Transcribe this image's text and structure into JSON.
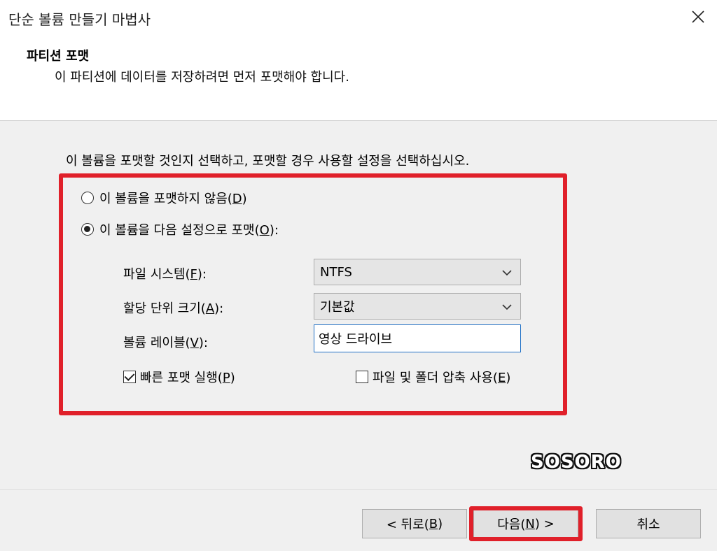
{
  "window": {
    "title": "단순 볼륨 만들기 마법사",
    "close_icon": "close-icon"
  },
  "header": {
    "heading": "파티션 포맷",
    "subheading": "이 파티션에 데이터를 저장하려면 먼저 포맷해야 합니다."
  },
  "body": {
    "instruction": "이 볼륨을 포맷할 것인지 선택하고, 포맷할 경우 사용할 설정을 선택하십시오.",
    "option_no_format": {
      "label": "이 볼륨을 포맷하지 않음(",
      "key": "D",
      "suffix": ")",
      "selected": false
    },
    "option_format": {
      "label": "이 볼륨을 다음 설정으로 포맷(",
      "key": "O",
      "suffix": "):",
      "selected": true
    },
    "filesystem": {
      "label": "파일 시스템(",
      "key": "F",
      "suffix": "):",
      "value": "NTFS"
    },
    "allocation": {
      "label": "할당 단위 크기(",
      "key": "A",
      "suffix": "):",
      "value": "기본값"
    },
    "volume_label": {
      "label": "볼륨 레이블(",
      "key": "V",
      "suffix": "):",
      "value": "영상 드라이브"
    },
    "quick_format": {
      "label": "빠른 포맷 실행(",
      "key": "P",
      "suffix": ")",
      "checked": true
    },
    "compression": {
      "label": "파일 및 폴더 압축 사용(",
      "key": "E",
      "suffix": ")",
      "checked": false
    }
  },
  "watermark": "SOSORO",
  "footer": {
    "back": {
      "prefix": "< 뒤로(",
      "key": "B",
      "suffix": ")"
    },
    "next": {
      "prefix": "다음(",
      "key": "N",
      "suffix": ") >"
    },
    "cancel": "취소"
  },
  "colors": {
    "highlight": "#e0202a",
    "input_border": "#1f6fc5"
  }
}
